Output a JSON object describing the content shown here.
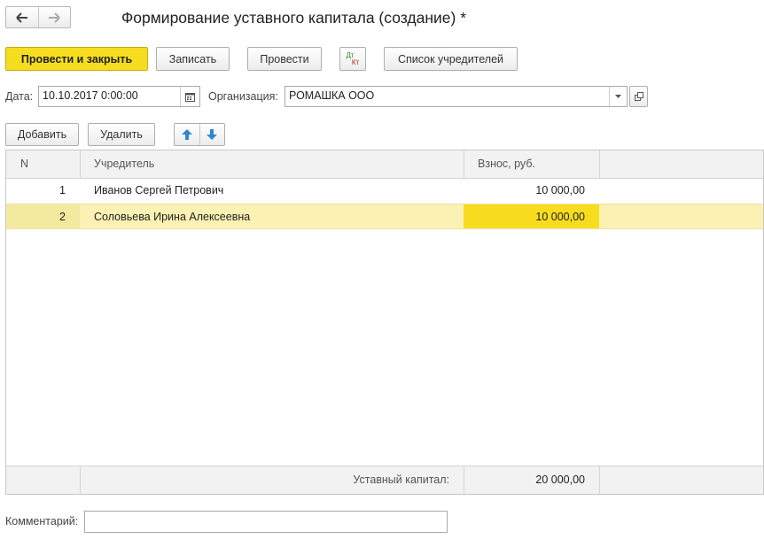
{
  "window": {
    "title": "Формирование уставного капитала (создание) *"
  },
  "toolbar": {
    "post_close": "Провести и закрыть",
    "save": "Записать",
    "post": "Провести",
    "dtkt_top": "Дт",
    "dtkt_bottom": "Кт",
    "founders_list": "Список учредителей"
  },
  "header": {
    "date_label": "Дата:",
    "date_value": "10.10.2017  0:00:00",
    "org_label": "Организация:",
    "org_value": "РОМАШКА ООО"
  },
  "table_toolbar": {
    "add": "Добавить",
    "delete": "Удалить"
  },
  "table": {
    "columns": [
      "N",
      "Учредитель",
      "Взнос, руб."
    ],
    "rows": [
      {
        "n": "1",
        "founder": "Иванов Сергей Петрович",
        "amount": "10 000,00"
      },
      {
        "n": "2",
        "founder": "Соловьева Ирина Алексеевна",
        "amount": "10 000,00"
      }
    ],
    "footer_label": "Уставный капитал:",
    "footer_total": "20 000,00"
  },
  "comment": {
    "label": "Комментарий:",
    "value": ""
  },
  "colors": {
    "primary": "#f7dd1f",
    "selected_row": "#fbf1b3",
    "selected_cell": "#f7dc1f",
    "arrow_blue": "#2f86d4"
  }
}
